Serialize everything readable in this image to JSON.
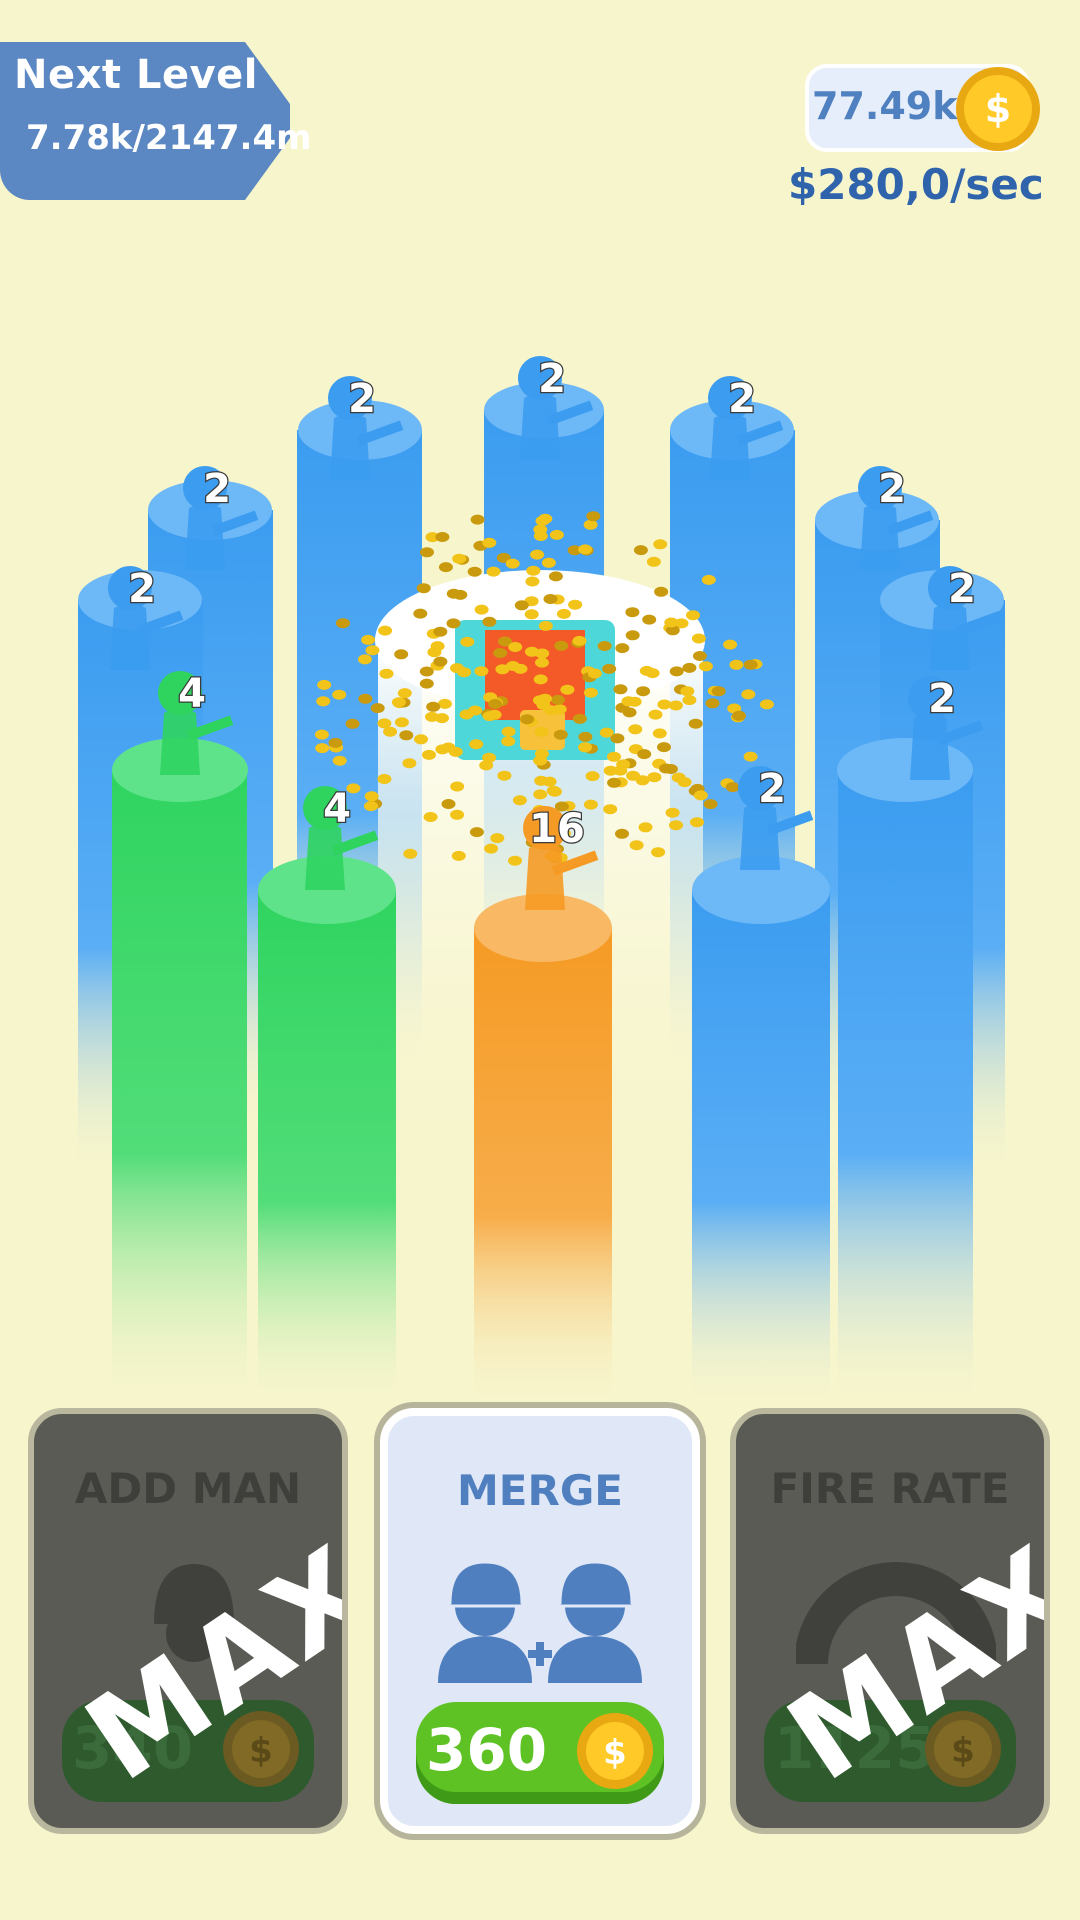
{
  "hud": {
    "level_title": "Next Level",
    "level_progress": "7.78k/2147.4m",
    "coins": "77.49k",
    "rate": "$280,0/sec",
    "coin_symbol": "$"
  },
  "units": [
    {
      "label": "2",
      "color": "blue"
    },
    {
      "label": "2",
      "color": "blue"
    },
    {
      "label": "2",
      "color": "blue"
    },
    {
      "label": "2",
      "color": "blue"
    },
    {
      "label": "2",
      "color": "blue"
    },
    {
      "label": "2",
      "color": "blue"
    },
    {
      "label": "2",
      "color": "blue"
    },
    {
      "label": "2",
      "color": "blue"
    },
    {
      "label": "2",
      "color": "blue"
    },
    {
      "label": "4",
      "color": "green"
    },
    {
      "label": "4",
      "color": "green"
    },
    {
      "label": "16",
      "color": "orange"
    }
  ],
  "colors": {
    "blue": "#3b9cf0",
    "green": "#2fd45f",
    "orange": "#f59a24",
    "background": "#f7f5cc"
  },
  "cards": {
    "add_man": {
      "title": "ADD MAN",
      "price": "340",
      "overlay": "MAX",
      "icon": "helmet-icon"
    },
    "merge": {
      "title": "MERGE",
      "price": "360",
      "icon": "merge-soldiers-icon"
    },
    "fire_rate": {
      "title": "FIRE RATE",
      "price": "1125",
      "overlay": "MAX",
      "icon": "gauge-icon"
    }
  }
}
